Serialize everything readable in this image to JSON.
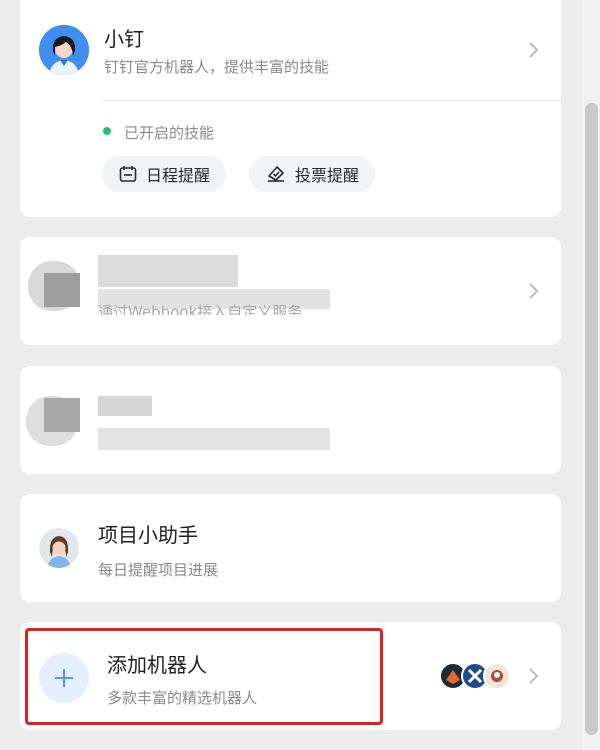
{
  "robots": {
    "xiaoding": {
      "name": "小钉",
      "description": "钉钉官方机器人，提供丰富的技能",
      "status_label": "已开启的技能",
      "skills": [
        "日程提醒",
        "投票提醒"
      ]
    },
    "webhook_robot": {
      "name": "",
      "description": "通过Webhook接入自定义服务"
    },
    "project_helper": {
      "name": "项目小助手",
      "description": "每日提醒项目进展"
    },
    "add_robot": {
      "name": "添加机器人",
      "description": "多款丰富的精选机器人"
    }
  },
  "colors": {
    "accent_blue": "#3d8bff",
    "status_green": "#1fbf74",
    "highlight_red": "#e0201d"
  },
  "icons": [
    "person-avatar-icon",
    "chevron-right-icon",
    "calendar-icon",
    "vote-icon",
    "plus-icon"
  ]
}
